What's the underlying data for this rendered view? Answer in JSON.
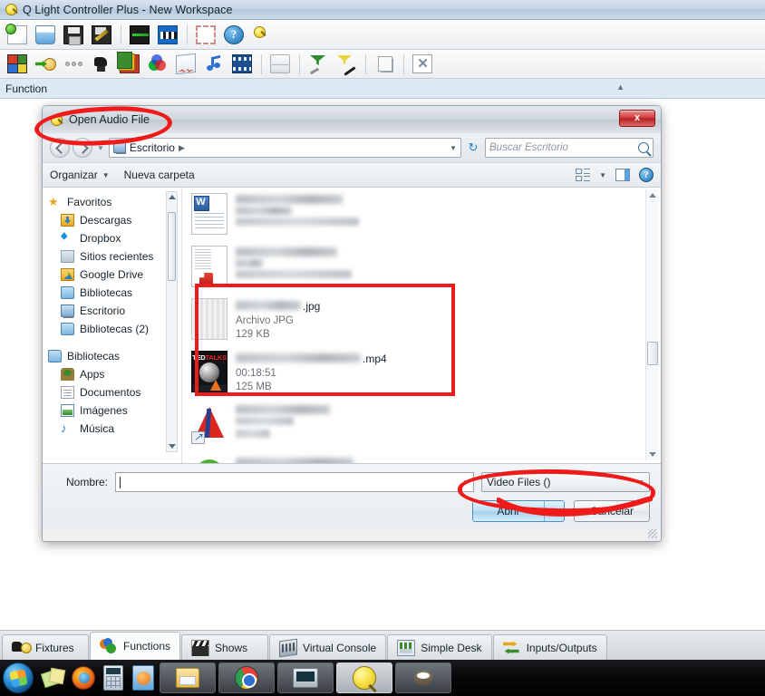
{
  "app": {
    "title": "Q Light Controller Plus - New Workspace",
    "title_icon": "lamp-icon",
    "toolbar_main": [
      {
        "name": "new-workspace-button",
        "icon": "new-document-icon"
      },
      {
        "name": "open-workspace-button",
        "icon": "open-folder-icon"
      },
      {
        "name": "save-workspace-button",
        "icon": "save-disk-icon"
      },
      {
        "name": "save-as-button",
        "icon": "save-as-pencil-icon"
      },
      {
        "name": "monitor-button",
        "icon": "monitor-icon"
      },
      {
        "name": "dmx-address-tool-button",
        "icon": "dip-switch-icon"
      },
      {
        "name": "fullscreen-button",
        "icon": "fullscreen-icon"
      },
      {
        "name": "help-button",
        "icon": "question-mark-icon"
      },
      {
        "name": "blackout-button",
        "icon": "lamp-icon"
      }
    ],
    "toolbar_function": [
      {
        "name": "add-scene-button",
        "icon": "scene-grid-icon"
      },
      {
        "name": "add-chaser-button",
        "icon": "chaser-arrow-icon"
      },
      {
        "name": "add-efx-button",
        "icon": "efx-dots-icon"
      },
      {
        "name": "add-sequence-button",
        "icon": "moving-head-icon"
      },
      {
        "name": "add-collection-button",
        "icon": "collection-stack-icon"
      },
      {
        "name": "add-rgb-matrix-button",
        "icon": "rgb-circles-icon"
      },
      {
        "name": "add-script-button",
        "icon": "script-scroll-icon"
      },
      {
        "name": "add-audio-button",
        "icon": "music-note-icon"
      },
      {
        "name": "add-video-button",
        "icon": "film-strip-icon"
      },
      {
        "name": "add-folder-button",
        "icon": "folder-icon"
      },
      {
        "name": "select-all-button",
        "icon": "green-filter-icon"
      },
      {
        "name": "wizard-button",
        "icon": "magic-wand-icon"
      },
      {
        "name": "clone-function-button",
        "icon": "copy-pages-icon"
      },
      {
        "name": "delete-function-button",
        "icon": "delete-page-icon"
      }
    ],
    "function_column_header": "Function",
    "sort_indicator": "▲"
  },
  "dialog": {
    "title": "Open Audio File",
    "title_icon": "lamp-icon",
    "close_label": "x",
    "nav": {
      "back_icon": "back-arrow-icon",
      "forward_icon": "forward-arrow-icon",
      "recent_locations_icon": "chevron-down-icon",
      "address_icon": "desktop-icon",
      "address_crumb": "Escritorio",
      "crumb_arrow": "▶",
      "address_caret": "▼",
      "refresh_icon": "refresh-icon",
      "refresh_glyph": "↻",
      "search_placeholder": "Buscar Escritorio",
      "search_icon": "search-icon"
    },
    "toolbar": {
      "organize_label": "Organizar",
      "organize_caret": "▼",
      "new_folder_label": "Nueva carpeta",
      "view_mode_icon": "view-list-icon",
      "view_caret": "▼",
      "preview_pane_icon": "preview-pane-icon",
      "help_icon": "help-icon",
      "help_glyph": "?"
    },
    "sidebar": {
      "favorites_group": {
        "label": "Favoritos",
        "icon": "star-icon"
      },
      "favorites": [
        {
          "label": "Descargas",
          "icon": "downloads-folder-icon"
        },
        {
          "label": "Dropbox",
          "icon": "dropbox-icon"
        },
        {
          "label": "Sitios recientes",
          "icon": "recent-places-icon"
        },
        {
          "label": "Google Drive",
          "icon": "google-drive-folder-icon"
        },
        {
          "label": "Bibliotecas",
          "icon": "libraries-folder-icon"
        },
        {
          "label": "Escritorio",
          "icon": "desktop-icon"
        },
        {
          "label": "Bibliotecas (2)",
          "icon": "libraries-folder-icon"
        }
      ],
      "libraries_group": {
        "label": "Bibliotecas",
        "icon": "libraries-folder-icon"
      },
      "libraries": [
        {
          "label": "Apps",
          "icon": "apps-icon"
        },
        {
          "label": "Documentos",
          "icon": "documents-icon"
        },
        {
          "label": "Imágenes",
          "icon": "pictures-icon"
        },
        {
          "label": "Música",
          "icon": "music-icon"
        }
      ]
    },
    "files": [
      {
        "name_suffix": "",
        "thumb": "word-document-icon",
        "blurred_name": true,
        "blurred_sub": true,
        "name_blur_widths": [
          118,
          62
        ],
        "sub_blur_width": 136,
        "sub_lines": 1,
        "highlighted": false
      },
      {
        "name_suffix": "",
        "thumb": "pdf-document-icon",
        "blurred_name": true,
        "blurred_sub": true,
        "name_blur_widths": [
          112,
          30
        ],
        "sub_blur_width": 128,
        "sub_lines": 1,
        "highlighted": false
      },
      {
        "name_suffix": ".jpg",
        "thumb": "jpg-thumbnail-icon",
        "blurred_name": true,
        "name_blur_widths": [
          72
        ],
        "type_label": "Archivo JPG",
        "size_label": "129 KB",
        "highlighted": true
      },
      {
        "name_suffix": ".mp4",
        "thumb": "ted-talks-video-thumbnail",
        "blurred_name": true,
        "name_blur_widths": [
          138
        ],
        "duration_label": "00:18:51",
        "size_label": "125 MB",
        "highlighted": true
      },
      {
        "name_suffix": "",
        "thumb": "red-tent-shortcut-icon",
        "blurred_name": true,
        "blurred_sub": true,
        "name_blur_widths": [
          104
        ],
        "sub_blur_width": 64,
        "sub_lines": 2,
        "highlighted": false
      },
      {
        "name_suffix": "",
        "thumb": "green-circle-icon",
        "blurred_name": true,
        "blurred_sub": true,
        "name_blur_widths": [
          130
        ],
        "sub_blur_width": 70,
        "sub_lines": 1,
        "highlighted": false
      }
    ],
    "footer": {
      "name_label": "Nombre:",
      "name_value": "",
      "name_caret": "▼",
      "filter_value": "Video Files ()",
      "filter_caret": "▼",
      "open_label": "Abrir",
      "open_split_caret": "▼",
      "cancel_label": "Cancelar"
    },
    "annotations": {
      "title_circle_color": "#ef1b1b",
      "files_rect_color": "#ef1b1b",
      "filter_circle_color": "#ef1b1b"
    }
  },
  "tabs": [
    {
      "label": "Fixtures",
      "icon": "fixtures-icon",
      "active": false
    },
    {
      "label": "Functions",
      "icon": "functions-icon",
      "active": true
    },
    {
      "label": "Shows",
      "icon": "shows-clapper-icon",
      "active": false
    },
    {
      "label": "Virtual Console",
      "icon": "virtual-console-icon",
      "active": false
    },
    {
      "label": "Simple Desk",
      "icon": "simple-desk-icon",
      "active": false
    },
    {
      "label": "Inputs/Outputs",
      "icon": "inputs-outputs-icon",
      "active": false
    }
  ],
  "taskbar": {
    "start_icon": "windows-start-orb",
    "quick_launch": [
      {
        "name": "sticky-notes-icon"
      },
      {
        "name": "firefox-icon"
      },
      {
        "name": "calculator-icon"
      },
      {
        "name": "windows-media-player-icon"
      }
    ],
    "running": [
      {
        "name": "file-explorer-icon",
        "active": false
      },
      {
        "name": "chrome-icon",
        "active": false
      },
      {
        "name": "system-monitor-icon",
        "active": false
      },
      {
        "name": "qlc-plus-icon",
        "active": true
      },
      {
        "name": "gimp-icon",
        "active": false
      }
    ]
  }
}
